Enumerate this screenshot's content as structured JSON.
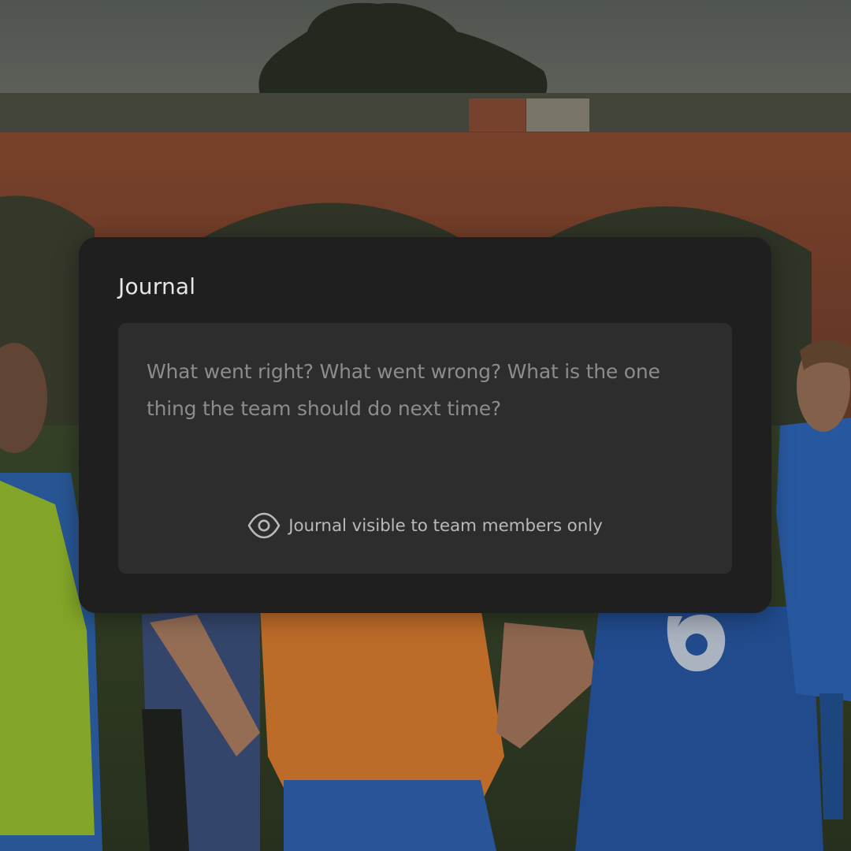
{
  "journal": {
    "title": "Journal",
    "entry_value": "",
    "entry_placeholder": "What went right? What went wrong? What is the one thing the team should do next time?",
    "visibility_note": "Journal visible to team members only",
    "visibility_icon": "eye-icon"
  },
  "colors": {
    "card_background": "#1f1f1f",
    "entry_background": "#2d2d2d",
    "title_text": "#e6e6e6",
    "placeholder_text": "#8c8c8c",
    "note_text": "#b9b9b9"
  }
}
